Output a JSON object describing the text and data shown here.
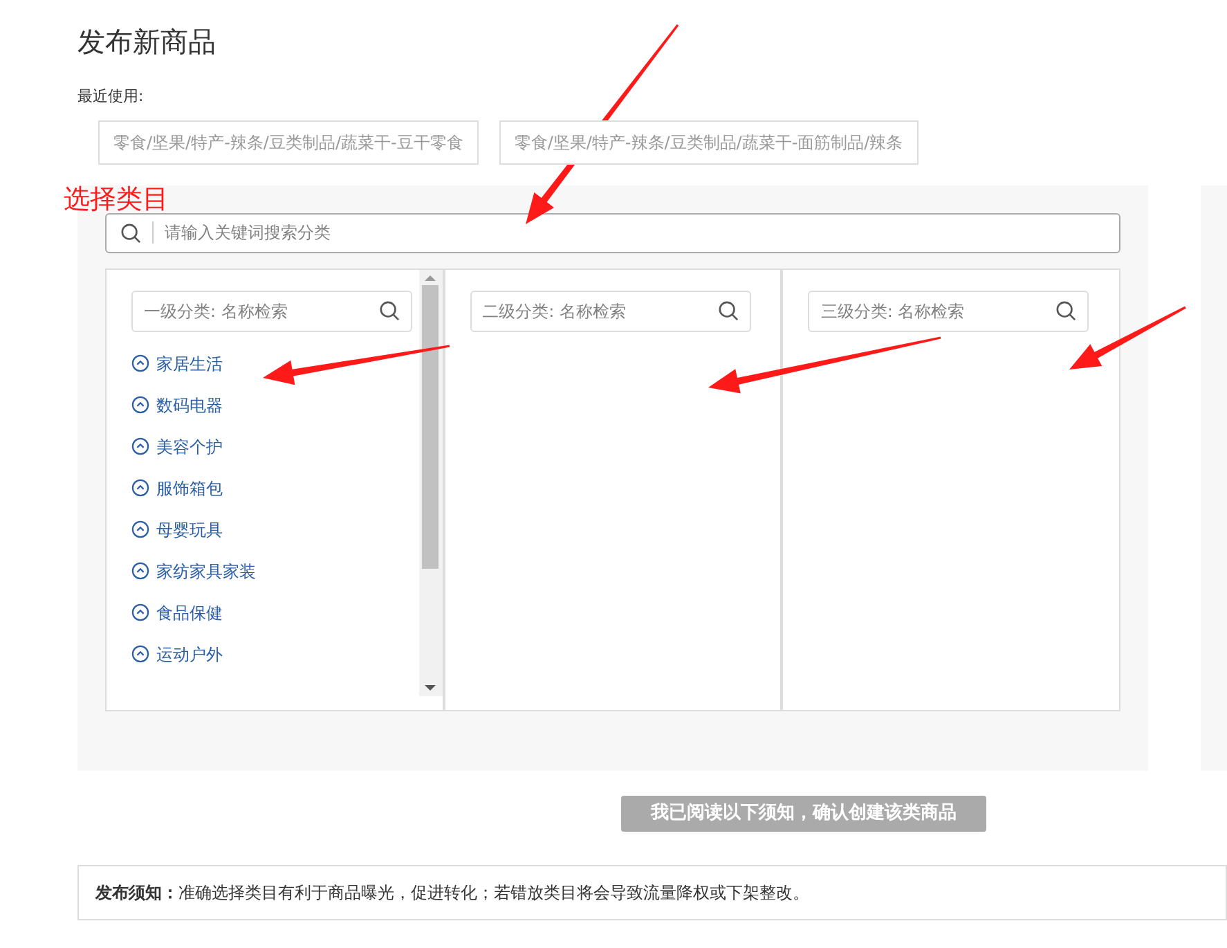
{
  "title": "发布新商品",
  "recent": {
    "label": "最近使用:",
    "items": [
      "零食/坚果/特产-辣条/豆类制品/蔬菜干-豆干零食",
      "零食/坚果/特产-辣条/豆类制品/蔬菜干-面筋制品/辣条"
    ]
  },
  "annotation": "选择类目",
  "search": {
    "placeholder": "请输入关键词搜索分类"
  },
  "columns": [
    {
      "placeholder": "一级分类: 名称检索",
      "items": [
        "家居生活",
        "数码电器",
        "美容个护",
        "服饰箱包",
        "母婴玩具",
        "家纺家具家装",
        "食品保健",
        "运动户外"
      ]
    },
    {
      "placeholder": "二级分类: 名称检索"
    },
    {
      "placeholder": "三级分类: 名称检索"
    }
  ],
  "confirm_button": {
    "label": "我已阅读以下须知，确认创建该类商品",
    "disabled": true
  },
  "notice": {
    "label": "发布须知：",
    "text": "准确选择类目有利于商品曝光，促进转化；若错放类目将会导致流量降权或下架整改。"
  }
}
